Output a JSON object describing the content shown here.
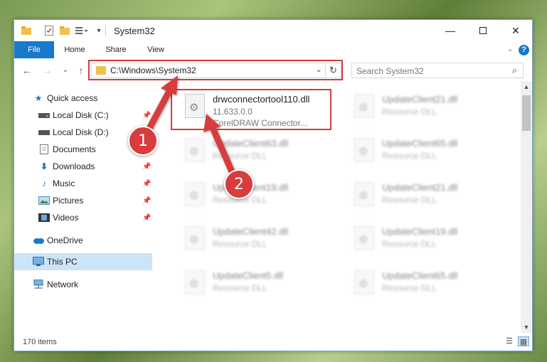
{
  "window": {
    "title": "System32",
    "minimize_icon": "minimize-icon",
    "maximize_icon": "maximize-icon",
    "close_icon": "close-icon"
  },
  "ribbon": {
    "tabs": [
      "File",
      "Home",
      "Share",
      "View"
    ],
    "help_label": "?"
  },
  "address": {
    "path": "C:\\Windows\\System32",
    "search_placeholder": "Search System32"
  },
  "sidebar": {
    "items": [
      {
        "label": "Quick access",
        "icon": "star-icon",
        "pinned": false
      },
      {
        "label": "Local Disk (C:)",
        "icon": "drive-icon",
        "pinned": true
      },
      {
        "label": "Local Disk (D:)",
        "icon": "drive-icon",
        "pinned": false
      },
      {
        "label": "Documents",
        "icon": "documents-icon",
        "pinned": true
      },
      {
        "label": "Downloads",
        "icon": "download-icon",
        "pinned": true
      },
      {
        "label": "Music",
        "icon": "music-icon",
        "pinned": true
      },
      {
        "label": "Pictures",
        "icon": "pictures-icon",
        "pinned": true
      },
      {
        "label": "Videos",
        "icon": "videos-icon",
        "pinned": true
      },
      {
        "label": "OneDrive",
        "icon": "cloud-icon",
        "pinned": false
      },
      {
        "label": "This PC",
        "icon": "computer-icon",
        "pinned": false,
        "selected": true
      },
      {
        "label": "Network",
        "icon": "network-icon",
        "pinned": false
      }
    ]
  },
  "files": {
    "highlighted": {
      "name": "drwconnectortool110.dll",
      "version": "11.633.0.0",
      "description": "CorelDRAW Connector..."
    },
    "others": [
      {
        "name": "UpdateClient21.dll",
        "type": "Resource DLL"
      },
      {
        "name": "UpdateClient63.dll",
        "type": "Resource DLL"
      },
      {
        "name": "UpdateClient65.dll",
        "type": "Resource DLL"
      },
      {
        "name": "UpdateClient19.dll",
        "type": "Resource DLL"
      },
      {
        "name": "UpdateClient21.dll",
        "type": "Resource DLL"
      },
      {
        "name": "UpdateClient42.dll",
        "type": "Resource DLL"
      },
      {
        "name": "UpdateClient19.dll",
        "type": "Resource DLL"
      },
      {
        "name": "UpdateClient5.dll",
        "type": "Resource DLL"
      },
      {
        "name": "UpdateClient65.dll",
        "type": "Resource DLL"
      }
    ]
  },
  "status": {
    "item_count": "170 items"
  },
  "annotations": {
    "step1": "1",
    "step2": "2",
    "color": "#d83c3c"
  }
}
